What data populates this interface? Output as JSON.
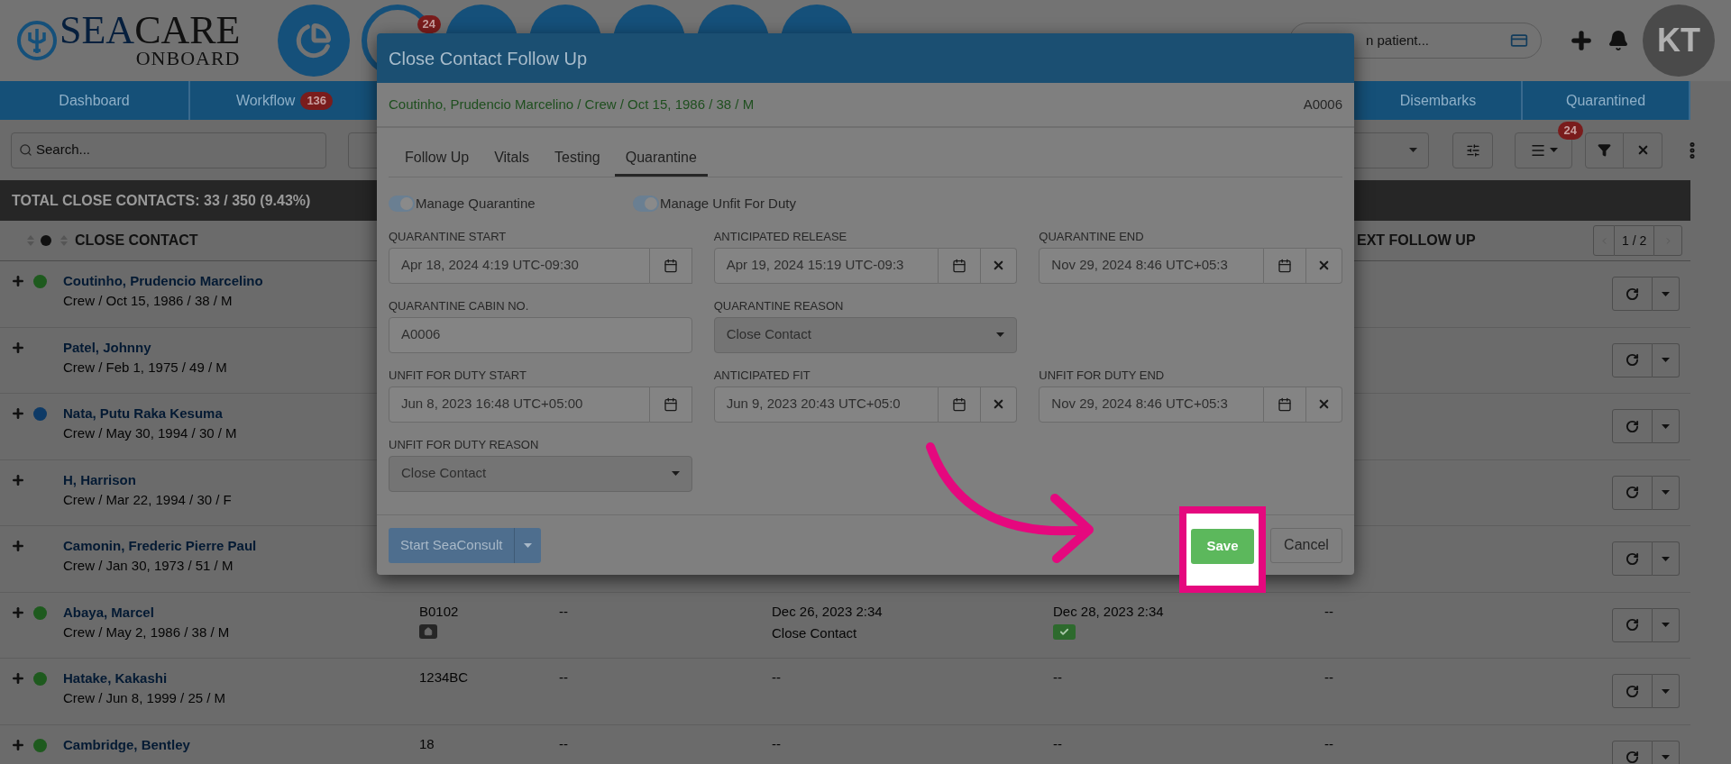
{
  "header": {
    "logo": {
      "word_1": "SEA",
      "word_2": "CARE",
      "tagline": "ONBOARD"
    },
    "nav_buttons": [
      {
        "kind": "chart"
      },
      {
        "kind": "ring",
        "badge": "24"
      },
      {
        "kind": "plain"
      },
      {
        "kind": "plain"
      },
      {
        "kind": "plain"
      },
      {
        "kind": "plain"
      },
      {
        "kind": "plain"
      }
    ],
    "patient_search": {
      "placeholder": "n patient..."
    },
    "user": {
      "initials": "KT"
    }
  },
  "nav_tabs": [
    {
      "label": "Dashboard"
    },
    {
      "label": "Workflow",
      "badge": "136"
    },
    {
      "label": "Disembarks"
    },
    {
      "label": "Quarantined"
    }
  ],
  "toolbar": {
    "search": {
      "placeholder": "Search..."
    },
    "list_badge": "24"
  },
  "summary": "TOTAL CLOSE CONTACTS: 33 / 350 (9.43%)",
  "columns": [
    "CLOSE CONTACT",
    "EXT FOLLOW UP"
  ],
  "pager": "1 / 2",
  "rows": [
    {
      "name": "Coutinho, Prudencio Marcelino",
      "info": "Crew / Oct 15, 1986 / 38 / M",
      "color": "#1e5a1e"
    },
    {
      "name": "Patel, Johnny",
      "info": "Crew / Feb 1, 1975 / 49 / M"
    },
    {
      "name": "Nata, Putu Raka Kesuma",
      "info": "Crew / May 30, 1994 / 30 / M",
      "color": "#0e3a66"
    },
    {
      "name": "H, Harrison",
      "info": "Crew / Mar 22, 1994 / 30 / F"
    },
    {
      "name": "Camonin, Frederic Pierre Paul",
      "info": "Crew / Jan 30, 1973 / 51 / M"
    },
    {
      "name": "Abaya, Marcel",
      "info": "Crew / May 2, 1986 / 38 / M",
      "color": "#1e5a1e",
      "cabin": "B0102",
      "cabin_badge": true,
      "cells": [
        {
          "text": "--"
        },
        {
          "text": "Dec 26, 2023 2:34",
          "sub": "Close Contact"
        },
        {
          "text": "Dec 28, 2023 2:34",
          "check": true
        },
        {
          "text": "--"
        }
      ]
    },
    {
      "name": "Hatake, Kakashi",
      "info": "Crew / Jun 8, 1999 / 25 / M",
      "color": "#1e5a1e",
      "cabin": "1234BC",
      "cells": [
        {
          "text": "--"
        },
        {
          "text": "--"
        },
        {
          "text": "--"
        },
        {
          "text": "--"
        }
      ]
    },
    {
      "name": "Cambridge, Bentley",
      "color": "#1e5a1e",
      "cabin": "18",
      "cells": [
        {
          "text": "--"
        },
        {
          "text": "--"
        },
        {
          "text": "--"
        },
        {
          "text": "--"
        }
      ]
    }
  ],
  "modal": {
    "title": "Close Contact Follow Up",
    "patient": "Coutinho, Prudencio Marcelino / Crew / Oct 15, 1986 / 38 / M",
    "cabin": "A0006",
    "tabs": [
      {
        "label": "Follow Up",
        "selected": false
      },
      {
        "label": "Vitals",
        "selected": false
      },
      {
        "label": "Testing",
        "selected": false
      },
      {
        "label": "Quarantine",
        "selected": true
      }
    ],
    "toggles": [
      {
        "label": "Manage Quarantine",
        "on": true
      },
      {
        "label": "Manage Unfit For Duty",
        "on": true
      }
    ],
    "field_rows": [
      [
        {
          "label": "QUARANTINE START",
          "kind": "date",
          "value": "Apr 18, 2024 4:19 UTC-09:30",
          "clearable": false
        },
        {
          "label": "ANTICIPATED RELEASE",
          "kind": "date",
          "value": "Apr 19, 2024 15:19 UTC-09:3",
          "clearable": true
        },
        {
          "label": "QUARANTINE END",
          "kind": "date",
          "value": "Nov 29, 2024 8:46 UTC+05:3",
          "clearable": true
        }
      ],
      [
        {
          "label": "QUARANTINE CABIN NO.",
          "kind": "text",
          "value": "A0006"
        },
        {
          "label": "QUARANTINE REASON",
          "kind": "select",
          "value": "Close Contact"
        }
      ],
      [
        {
          "label": "UNFIT FOR DUTY START",
          "kind": "date",
          "value": "Jun 8, 2023 16:48 UTC+05:00",
          "clearable": false
        },
        {
          "label": "ANTICIPATED FIT",
          "kind": "date",
          "value": "Jun 9, 2023 20:43 UTC+05:0",
          "clearable": true
        },
        {
          "label": "UNFIT FOR DUTY END",
          "kind": "date",
          "value": "Nov 29, 2024 8:46 UTC+05:3",
          "clearable": true
        }
      ],
      [
        {
          "label": "UNFIT FOR DUTY REASON",
          "kind": "select",
          "value": "Close Contact"
        }
      ]
    ],
    "buttons": {
      "consult": "Start SeaConsult",
      "save": "Save",
      "cancel": "Cancel"
    }
  }
}
